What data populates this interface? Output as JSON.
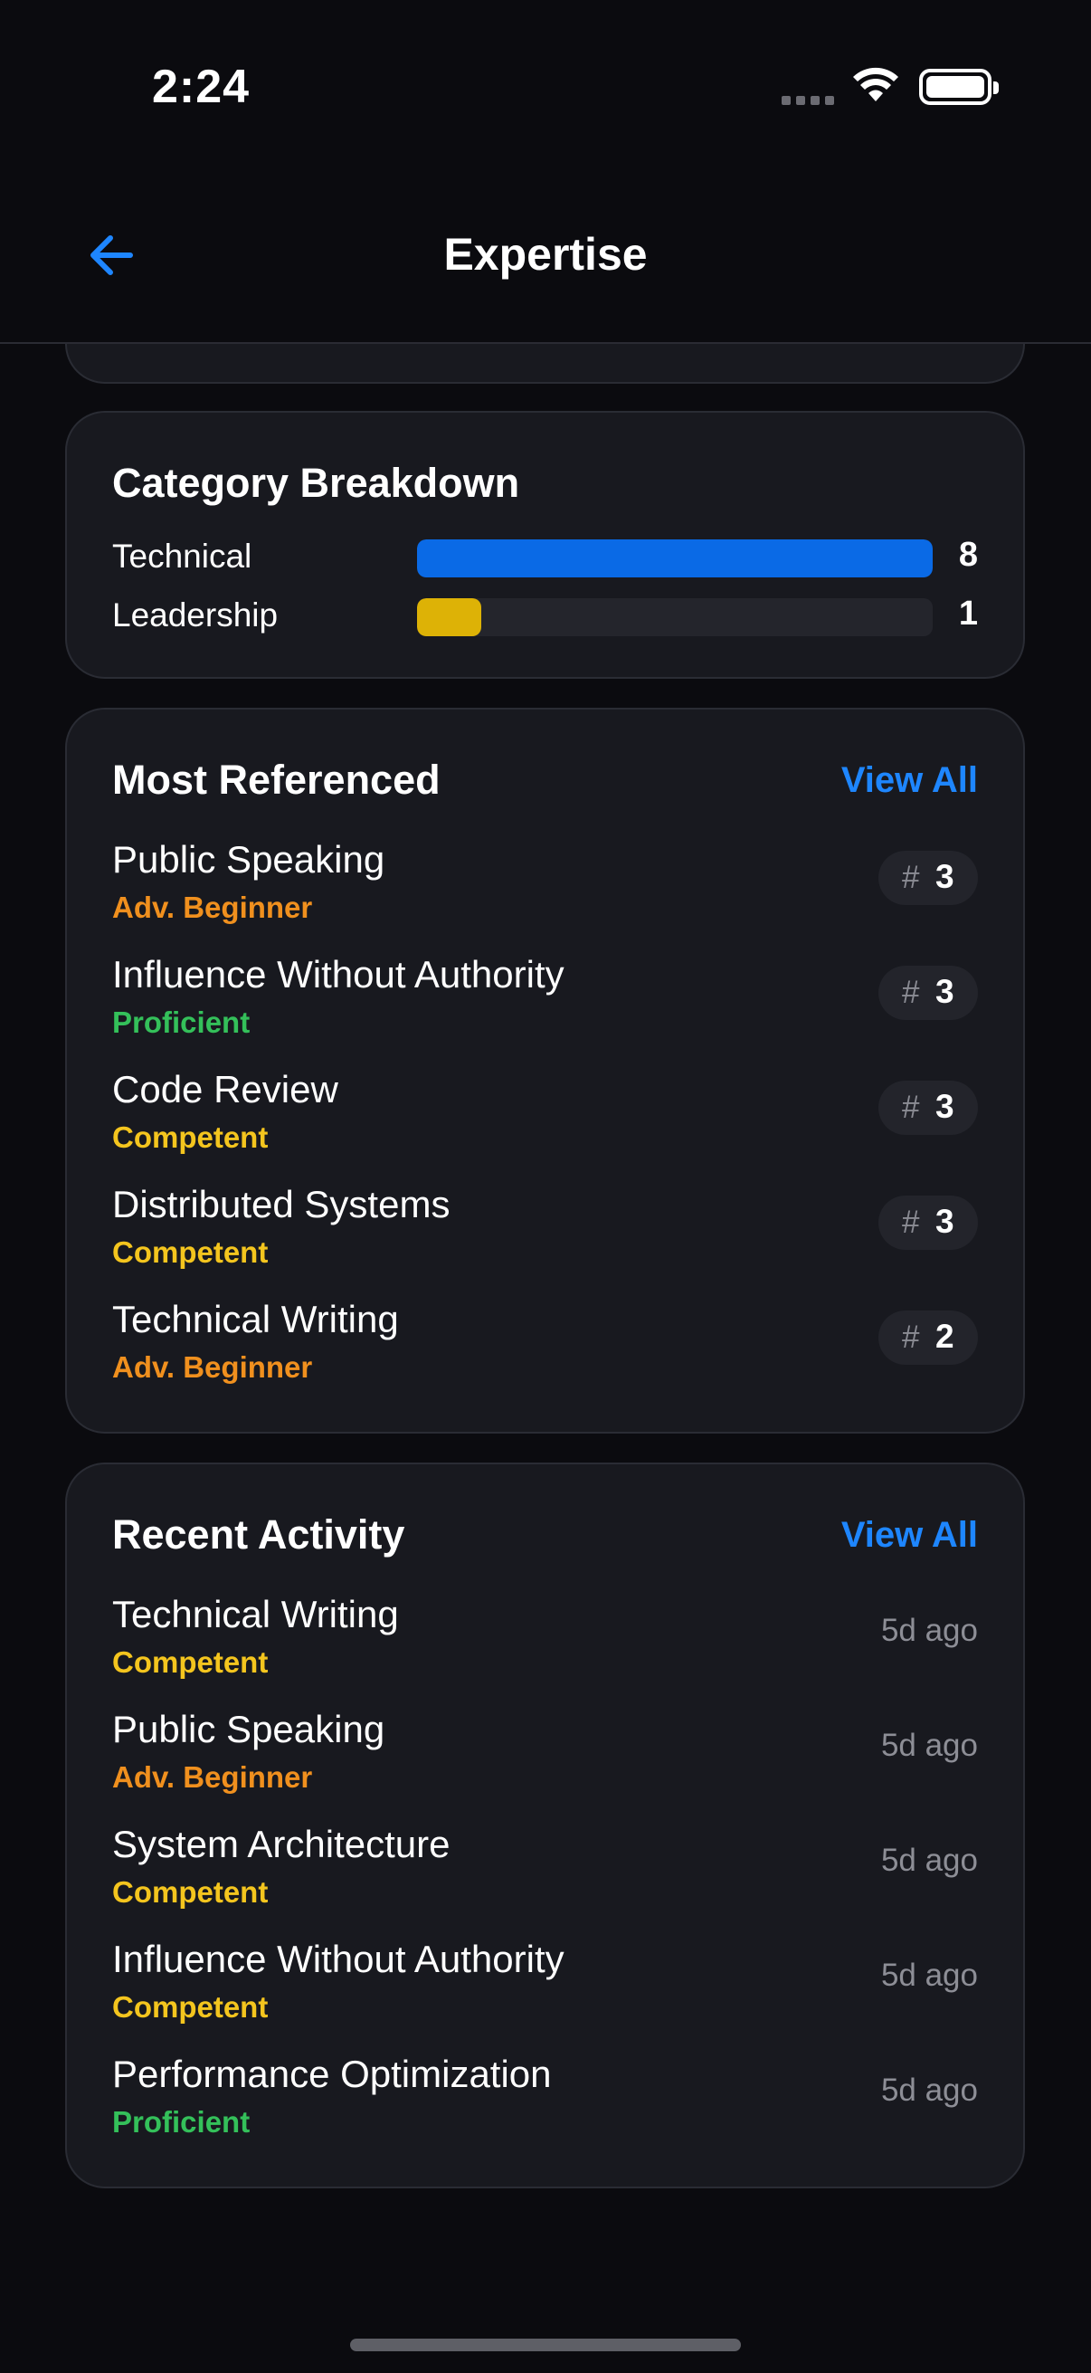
{
  "status_bar": {
    "time": "2:24"
  },
  "nav": {
    "title": "Expertise",
    "back_icon": "arrow-left-icon"
  },
  "colors": {
    "accent": "#1e86ff",
    "technical_bar": "#0a6ae6",
    "leadership_bar": "#ddb206",
    "adv_beginner": "#f0901e",
    "proficient": "#34c05a",
    "competent": "#f4c51e"
  },
  "category_breakdown": {
    "title": "Category Breakdown",
    "max": 8,
    "rows": [
      {
        "label": "Technical",
        "count": "8",
        "value": 8,
        "color": "#0a6ae6"
      },
      {
        "label": "Leadership",
        "count": "1",
        "value": 1,
        "color": "#ddb206"
      }
    ]
  },
  "most_referenced": {
    "title": "Most Referenced",
    "view_all": "View All",
    "items": [
      {
        "name": "Public Speaking",
        "level": "Adv. Beginner",
        "level_color": "#f0901e",
        "hash": "#",
        "count": "3"
      },
      {
        "name": "Influence Without Authority",
        "level": "Proficient",
        "level_color": "#34c05a",
        "hash": "#",
        "count": "3"
      },
      {
        "name": "Code Review",
        "level": "Competent",
        "level_color": "#f4c51e",
        "hash": "#",
        "count": "3"
      },
      {
        "name": "Distributed Systems",
        "level": "Competent",
        "level_color": "#f4c51e",
        "hash": "#",
        "count": "3"
      },
      {
        "name": "Technical Writing",
        "level": "Adv. Beginner",
        "level_color": "#f0901e",
        "hash": "#",
        "count": "2"
      }
    ]
  },
  "recent_activity": {
    "title": "Recent Activity",
    "view_all": "View All",
    "items": [
      {
        "name": "Technical Writing",
        "level": "Competent",
        "level_color": "#f4c51e",
        "time": "5d ago"
      },
      {
        "name": "Public Speaking",
        "level": "Adv. Beginner",
        "level_color": "#f0901e",
        "time": "5d ago"
      },
      {
        "name": "System Architecture",
        "level": "Competent",
        "level_color": "#f4c51e",
        "time": "5d ago"
      },
      {
        "name": "Influence Without Authority",
        "level": "Competent",
        "level_color": "#f4c51e",
        "time": "5d ago"
      },
      {
        "name": "Performance Optimization",
        "level": "Proficient",
        "level_color": "#34c05a",
        "time": "5d ago"
      }
    ]
  }
}
